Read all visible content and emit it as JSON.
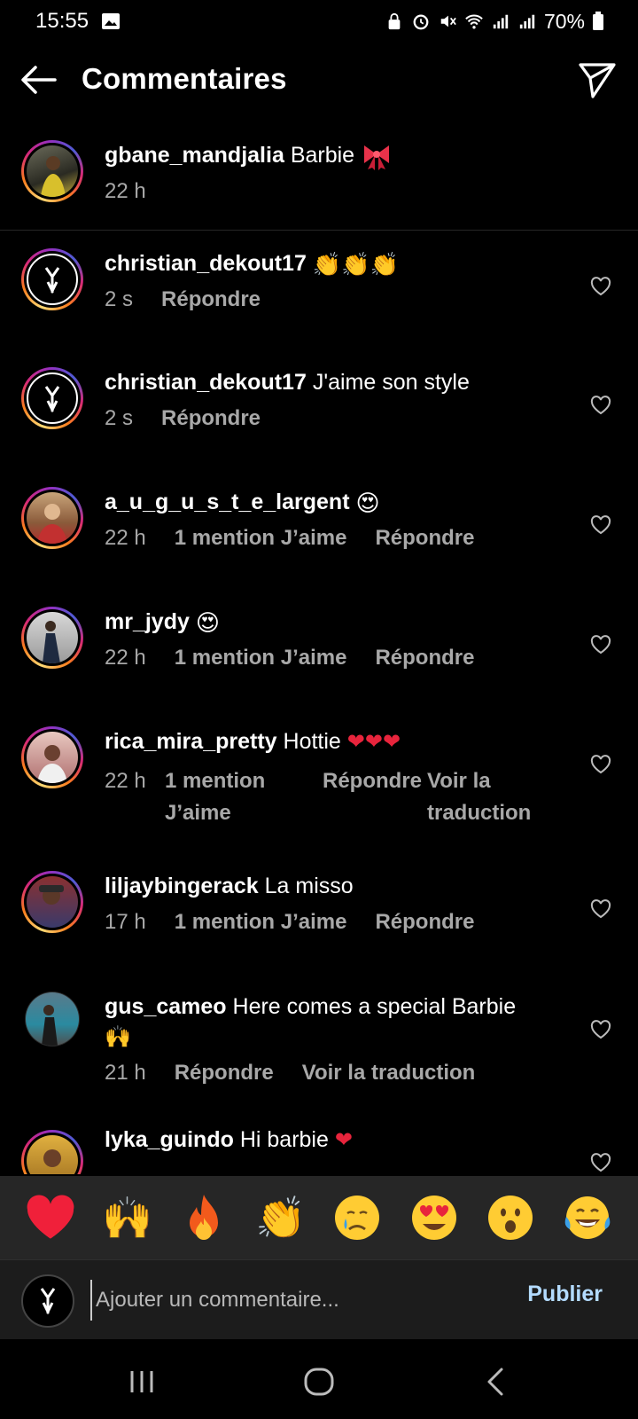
{
  "status_bar": {
    "time": "15:55",
    "battery": "70%"
  },
  "header": {
    "title": "Commentaires"
  },
  "caption": {
    "username": "gbane_mandjalia",
    "text": "Barbie",
    "time": "22 h"
  },
  "comments": [
    {
      "username": "christian_dekout17",
      "text": "",
      "time": "2 s",
      "likes": "",
      "reply": "Répondre",
      "translate": ""
    },
    {
      "username": "christian_dekout17",
      "text": "J'aime son style",
      "time": "2 s",
      "likes": "",
      "reply": "Répondre",
      "translate": ""
    },
    {
      "username": "a_u_g_u_s_t_e_largent",
      "text": "",
      "time": "22 h",
      "likes": "1 mention J’aime",
      "reply": "Répondre",
      "translate": ""
    },
    {
      "username": "mr_jydy",
      "text": "",
      "time": "22 h",
      "likes": "1 mention J’aime",
      "reply": "Répondre",
      "translate": ""
    },
    {
      "username": "rica_mira_pretty",
      "text": "Hottie",
      "time": "22 h",
      "likes": "1 mention J’aime",
      "reply": "Répondre",
      "translate": "Voir la traduction"
    },
    {
      "username": "liljaybingerack",
      "text": "La misso",
      "time": "17 h",
      "likes": "1 mention J’aime",
      "reply": "Répondre",
      "translate": ""
    },
    {
      "username": "gus_cameo",
      "text": "Here comes a special Barbie",
      "time": "21 h",
      "likes": "",
      "reply": "Répondre",
      "translate": "Voir la traduction"
    },
    {
      "username": "lyka_guindo",
      "text": "Hi barbie",
      "time": "",
      "likes": "",
      "reply": "",
      "translate": ""
    }
  ],
  "reactions": [
    "heart",
    "raised-hands",
    "fire",
    "clapping",
    "crying",
    "heart-eyes",
    "surprised",
    "laughing"
  ],
  "composer": {
    "placeholder": "Ajouter un commentaire...",
    "publish_label": "Publier"
  },
  "colors": {
    "background": "#000000",
    "secondary_text": "#a8a8a8",
    "publish": "#b3dbff",
    "reaction_bar": "#262626"
  }
}
